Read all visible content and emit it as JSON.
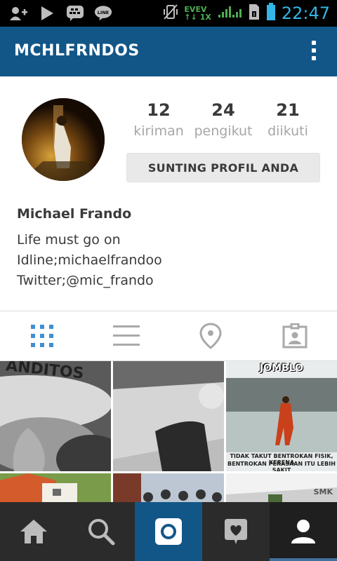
{
  "status_bar": {
    "time": "22:47",
    "network_top": "EVEV",
    "network_bottom": "1X",
    "icons": [
      "add-contact-icon",
      "play-store-icon",
      "bbm-icon",
      "line-icon",
      "vibrate-off-icon",
      "signal-icon",
      "sim-icon",
      "battery-icon"
    ]
  },
  "header": {
    "username": "MCHLFRNDOS",
    "menu_icon": "overflow-menu-icon"
  },
  "profile": {
    "stats": [
      {
        "value": "12",
        "label": "kiriman"
      },
      {
        "value": "24",
        "label": "pengikut"
      },
      {
        "value": "21",
        "label": "diikuti"
      }
    ],
    "edit_button": "SUNTING PROFIL ANDA",
    "full_name": "Michael Frando",
    "bio_lines": [
      "Life must go on",
      "Idline;michaelfrandoo",
      "Twitter;@mic_frando"
    ]
  },
  "view_tabs": [
    {
      "icon": "grid-view-icon",
      "active": true
    },
    {
      "icon": "list-view-icon",
      "active": false
    },
    {
      "icon": "location-pin-icon",
      "active": false
    },
    {
      "icon": "tagged-photos-icon",
      "active": false
    }
  ],
  "grid": {
    "tiles": [
      {
        "caption": "ANDITOS"
      },
      {
        "caption": ""
      },
      {
        "caption": "JOMBLO",
        "subcaption_1": "TIDAK TAKUT BENTROKAN FISIK, KERENA",
        "subcaption_2": "BENTROKAN PERASAAN ITU LEBIH SAKIT"
      },
      {
        "caption": ""
      },
      {
        "caption": ""
      },
      {
        "caption": "SMK"
      }
    ]
  },
  "bottom_nav": [
    {
      "icon": "home-icon",
      "active": false
    },
    {
      "icon": "search-icon",
      "active": false
    },
    {
      "icon": "camera-icon",
      "active": false
    },
    {
      "icon": "activity-heart-icon",
      "active": false
    },
    {
      "icon": "profile-icon",
      "active": true
    }
  ],
  "colors": {
    "brand_blue": "#125688",
    "accent_blue": "#3f729b",
    "status_clock": "#33b5e5"
  }
}
